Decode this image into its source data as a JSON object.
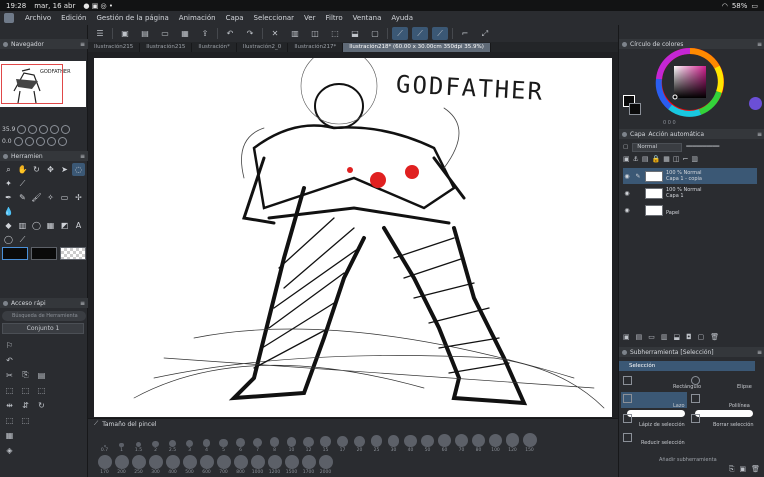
{
  "status_bar": {
    "time": "19:28",
    "date": "mar, 16 abr",
    "battery": "58%"
  },
  "menu": [
    "Archivo",
    "Edición",
    "Gestión de la página",
    "Animación",
    "Capa",
    "Seleccionar",
    "Ver",
    "Filtro",
    "Ventana",
    "Ayuda"
  ],
  "tabs": [
    {
      "label": "Ilustración215",
      "active": false
    },
    {
      "label": "Ilustración215",
      "active": false
    },
    {
      "label": "Ilustración*",
      "active": false
    },
    {
      "label": "Ilustración2_0",
      "active": false
    },
    {
      "label": "Ilustración217*",
      "active": false
    },
    {
      "label": "Ilustración218* (60.00 x 30.00cm 350dpi 35.9%)",
      "active": true
    }
  ],
  "navigator": {
    "title": "Navegador",
    "zoom": "35.9",
    "rotation": "0.0"
  },
  "tools_panel": {
    "title": "Herramien"
  },
  "quick_access": {
    "title": "Acceso rápi",
    "search_placeholder": "Búsqueda de Herramienta",
    "set_label": "Conjunto 1"
  },
  "canvas": {
    "title_text": "GODFATHER"
  },
  "brush_size": {
    "title": "Tamaño del pincel",
    "sizes": [
      "0.7",
      "1",
      "1.5",
      "2",
      "2.5",
      "3",
      "4",
      "5",
      "6",
      "7",
      "8",
      "10",
      "12",
      "15",
      "17",
      "20",
      "25",
      "30",
      "40",
      "50",
      "60",
      "70",
      "80",
      "100",
      "120",
      "150",
      "170",
      "200",
      "250",
      "300",
      "400",
      "500",
      "600",
      "700",
      "800",
      "1000",
      "1200",
      "1500",
      "1700",
      "2000"
    ]
  },
  "color_panel": {
    "title": "Círculo de colores",
    "readout": "0  0  0"
  },
  "layer_panel": {
    "title": "Capa",
    "tab2": "Acción automática",
    "blend_mode": "Normal",
    "layers": [
      {
        "line1": "100 % Normal",
        "line2": "Capa 1 - copia",
        "active": true
      },
      {
        "line1": "100 % Normal",
        "line2": "Capa 1",
        "active": false
      },
      {
        "line1": "",
        "line2": "Papel",
        "active": false
      }
    ]
  },
  "subtool_panel": {
    "title": "Subherramienta [Selección]",
    "selected": "Selección",
    "items": [
      "Rectángulo",
      "Elipse",
      "Lazo",
      "Polilínea",
      "Lápiz de selección",
      "Borrar selección",
      "Reducir selección"
    ],
    "add_label": "Añadir subherramienta"
  },
  "colors": {
    "accent": "#3b5875",
    "panel": "#2a2c30",
    "stroke_red": "#e02020"
  }
}
